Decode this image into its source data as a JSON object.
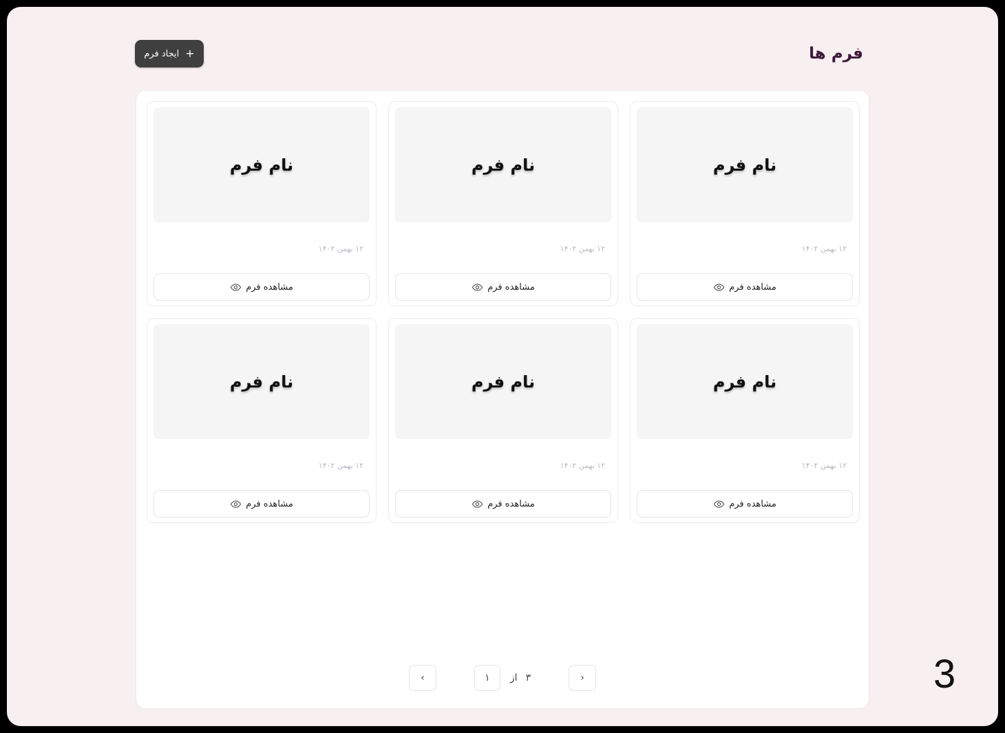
{
  "header": {
    "title": "فرم ها",
    "create_label": "ایجاد فرم",
    "create_icon": "+"
  },
  "cards": [
    {
      "title": "نام فرم",
      "date": "۱۲ بهمن ۱۴۰۲",
      "view_label": "مشاهده فرم"
    },
    {
      "title": "نام فرم",
      "date": "۱۲ بهمن ۱۴۰۲",
      "view_label": "مشاهده فرم"
    },
    {
      "title": "نام فرم",
      "date": "۱۲ بهمن ۱۴۰۲",
      "view_label": "مشاهده فرم"
    },
    {
      "title": "نام فرم",
      "date": "۱۲ بهمن ۱۴۰۲",
      "view_label": "مشاهده فرم"
    },
    {
      "title": "نام فرم",
      "date": "۱۲ بهمن ۱۴۰۲",
      "view_label": "مشاهده فرم"
    },
    {
      "title": "نام فرم",
      "date": "۱۲ بهمن ۱۴۰۲",
      "view_label": "مشاهده فرم"
    }
  ],
  "pagination": {
    "current": "۱",
    "of_label": "از",
    "total": "۳",
    "prev_icon": "‹",
    "next_icon": "›"
  },
  "slide_number": "3",
  "colors": {
    "page_bg": "#f8eff0",
    "title": "#3d1a3a",
    "create_button": "#3f3f3f"
  }
}
